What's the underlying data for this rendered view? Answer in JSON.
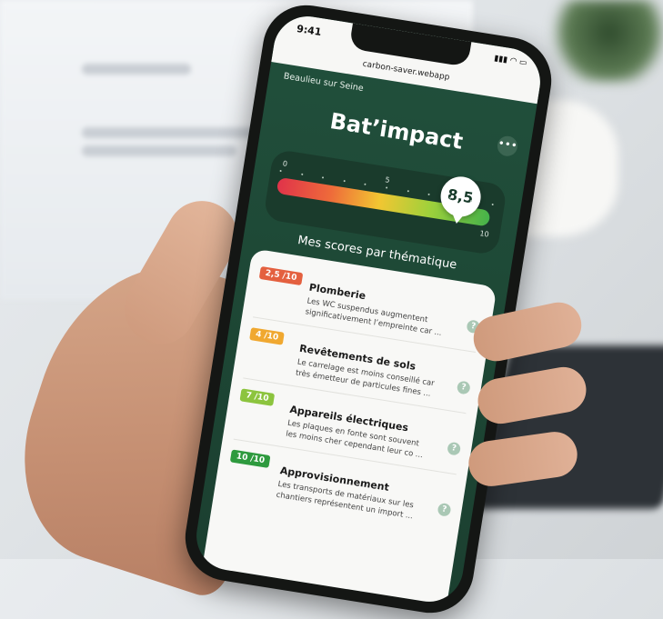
{
  "status_bar": {
    "time": "9:41",
    "icons": "signal-wifi-battery"
  },
  "browser": {
    "url": "carbon-saver.webapp"
  },
  "header": {
    "location": "Beaulieu sur Seine",
    "more_icon": "ellipsis-icon"
  },
  "app": {
    "title": "Bat’impact"
  },
  "gauge": {
    "min_label": "0",
    "mid_label": "5",
    "max_label": "10",
    "score": 8.5,
    "score_label": "8,5",
    "colors": [
      "#e0334a",
      "#ee6a3a",
      "#f2c632",
      "#9ed13b",
      "#45b24a"
    ]
  },
  "section_title": "Mes scores par thématique",
  "themes": [
    {
      "badge": "2,5 /10",
      "badge_color": "#e4603f",
      "title": "Plomberie",
      "desc": "Les WC suspendus augmentent significativement l’empreinte car ..."
    },
    {
      "badge": "4 /10",
      "badge_color": "#f0a830",
      "title": "Revêtements de sols",
      "desc": "Le carrelage est moins conseillé car très émetteur de particules fines ..."
    },
    {
      "badge": "7 /10",
      "badge_color": "#8cc43e",
      "title": "Appareils électriques",
      "desc": "Les plaques en fonte sont souvent les moins cher cependant leur co ..."
    },
    {
      "badge": "10 /10",
      "badge_color": "#2e9a3e",
      "title": "Approvisionnement",
      "desc": "Les transports de matériaux sur les chantiers représentent un import ..."
    }
  ],
  "help_label": "?"
}
